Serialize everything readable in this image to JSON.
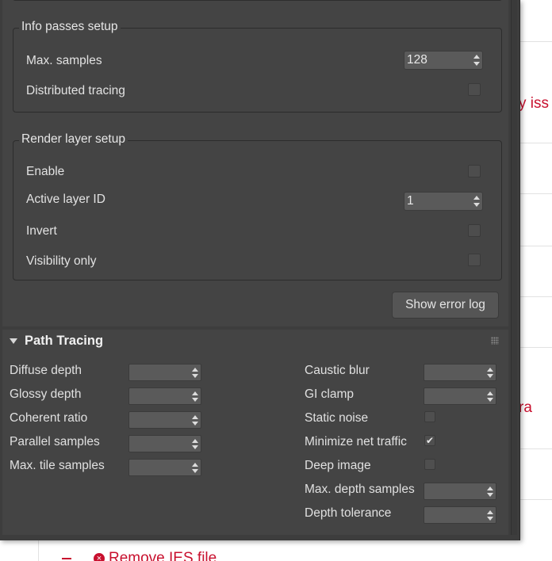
{
  "background": {
    "issues_text": "y iss",
    "ra_text": "ra",
    "remove_link": "Remove IES file"
  },
  "info_passes": {
    "legend": "Info passes setup",
    "max_samples_label": "Max. samples",
    "max_samples_value": "128",
    "distributed_label": "Distributed tracing",
    "distributed_checked": false
  },
  "render_layer": {
    "legend": "Render layer setup",
    "enable_label": "Enable",
    "active_layer_label": "Active layer ID",
    "active_layer_value": "1",
    "invert_label": "Invert",
    "visibility_label": "Visibility only"
  },
  "error_log_button": "Show error log",
  "path_tracing": {
    "title": "Path Tracing",
    "left": [
      {
        "label": "Diffuse depth",
        "value": ""
      },
      {
        "label": "Glossy depth",
        "value": ""
      },
      {
        "label": "Coherent ratio",
        "value": ""
      },
      {
        "label": "Parallel samples",
        "value": ""
      },
      {
        "label": "Max. tile samples",
        "value": ""
      }
    ],
    "right": [
      {
        "label": "Caustic blur",
        "kind": "spinner"
      },
      {
        "label": "GI clamp",
        "kind": "spinner"
      },
      {
        "label": "Static noise",
        "kind": "checkbox",
        "checked": false
      },
      {
        "label": "Minimize net traffic",
        "kind": "checkbox",
        "checked": true
      },
      {
        "label": "Deep image",
        "kind": "checkbox",
        "checked": false
      },
      {
        "label": "Max. depth samples",
        "kind": "spinner"
      },
      {
        "label": "Depth tolerance",
        "kind": "spinner"
      }
    ],
    "check_glyph": "✔"
  },
  "colors": {
    "panel_bg": "#444444",
    "link_red": "#c8102e"
  }
}
